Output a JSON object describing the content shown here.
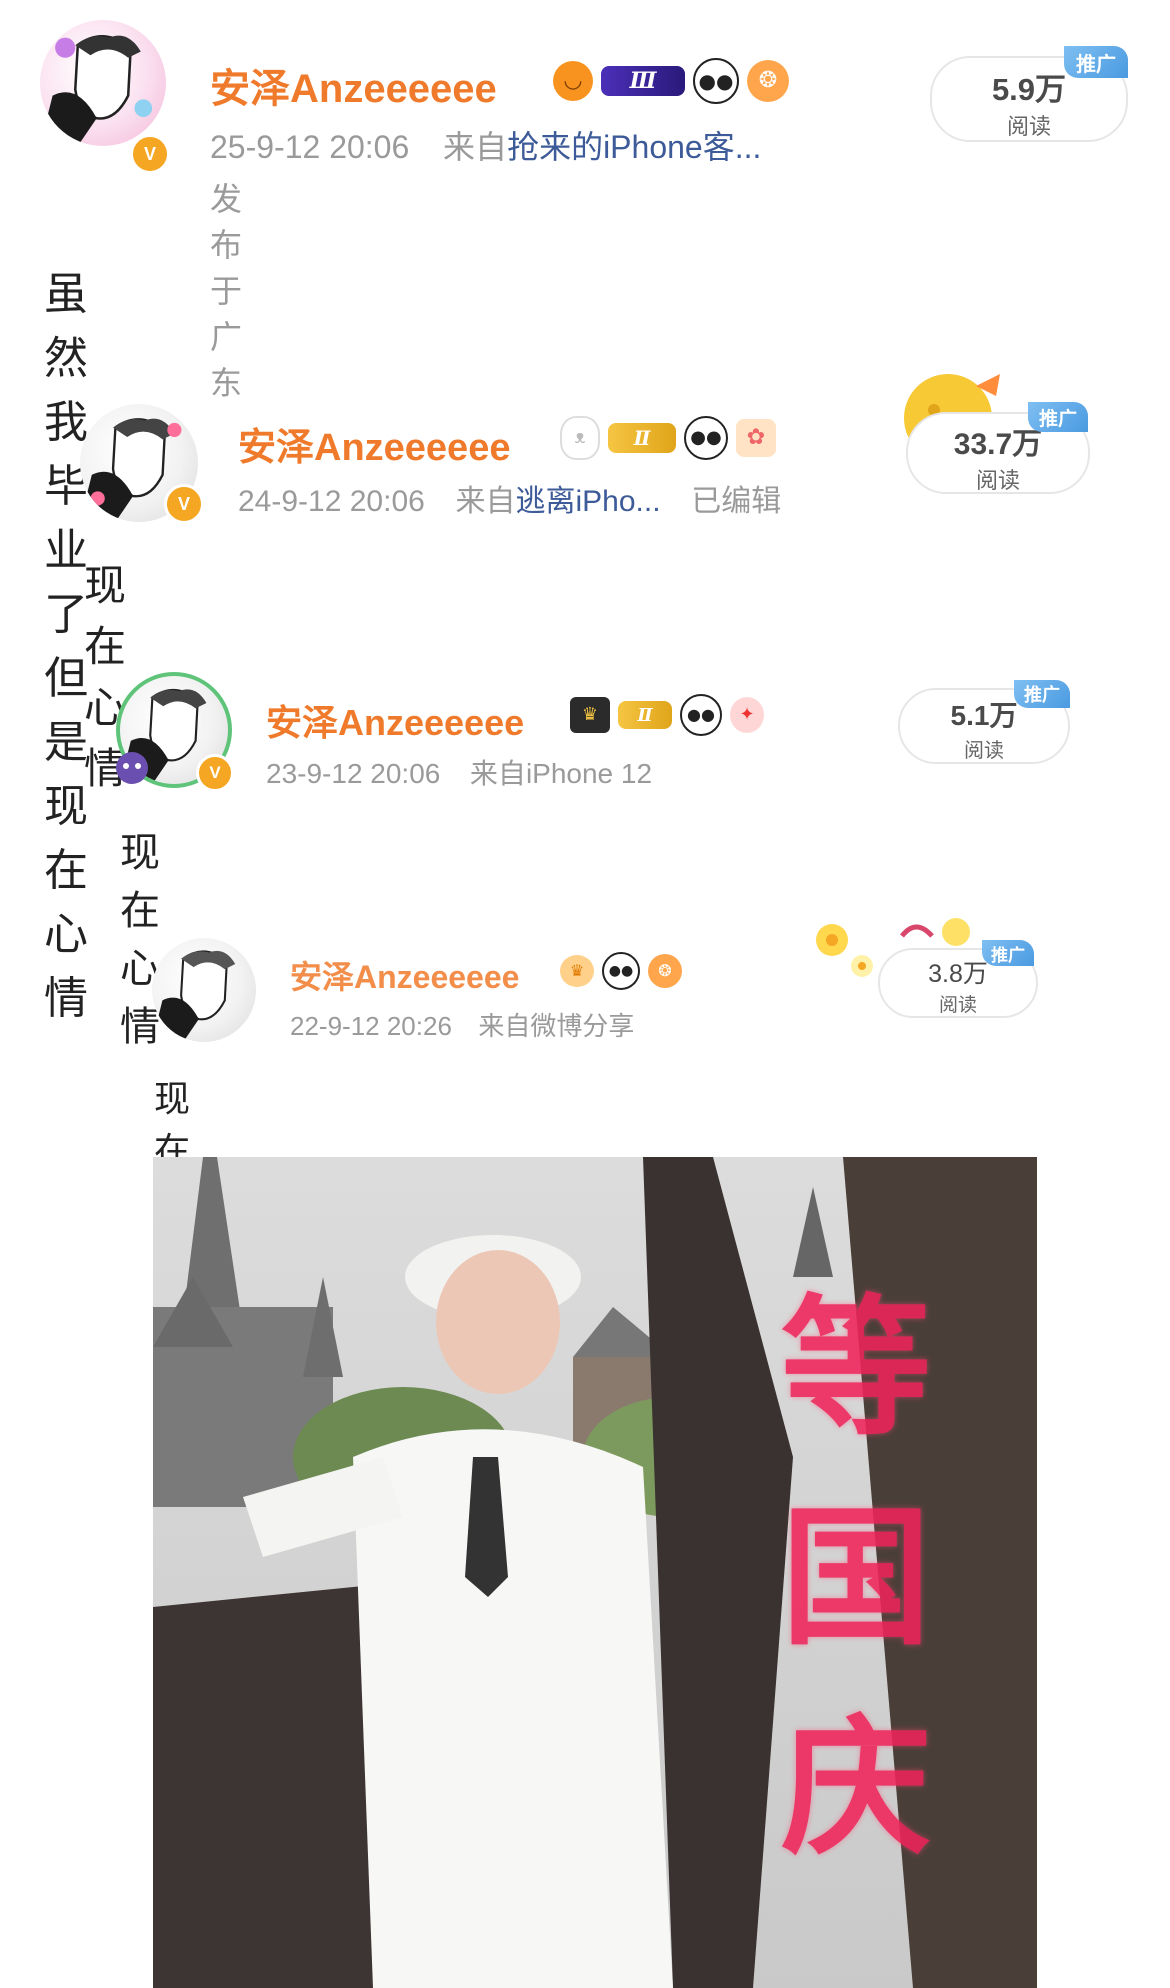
{
  "posts": [
    {
      "username": "安泽Anzeeeeee",
      "level": "Ⅲ",
      "datetime": "25-9-12 20:06",
      "source_prefix": "来自",
      "source": "抢来的iPhone客...",
      "location": "发布于 广东",
      "reads_count": "5.9万",
      "reads_label": "阅读",
      "promo_label": "推广",
      "text": "虽然我毕业了但是现在心情",
      "verified_mark": "V"
    },
    {
      "username": "安泽Anzeeeeee",
      "level": "Ⅱ",
      "datetime": "24-9-12 20:06",
      "source_prefix": "来自",
      "source": "逃离iPho...",
      "edited": "已编辑",
      "reads_count": "33.7万",
      "reads_label": "阅读",
      "promo_label": "推广",
      "text": "现在心情",
      "verified_mark": "V"
    },
    {
      "username": "安泽Anzeeeeee",
      "level": "Ⅱ",
      "datetime": "23-9-12 20:06",
      "source_prefix": "来自",
      "source": "iPhone 12",
      "reads_count": "5.1万",
      "reads_label": "阅读",
      "promo_label": "推广",
      "text": "现在心情",
      "verified_mark": "V"
    },
    {
      "username": "安泽Anzeeeeee",
      "datetime": "22-9-12 20:26",
      "source_prefix": "来自",
      "source": "微博分享",
      "reads_count": "3.8万",
      "reads_label": "阅读",
      "promo_label": "推广",
      "text": "现在心情"
    }
  ],
  "image_overlay": [
    "等",
    "国",
    "庆"
  ],
  "colors": {
    "username": "#f07a2b",
    "meta": "#9a9a9a",
    "source_link": "#3d5a99",
    "promo": "#4a9ae0",
    "overlay_text": "#f0245a"
  }
}
